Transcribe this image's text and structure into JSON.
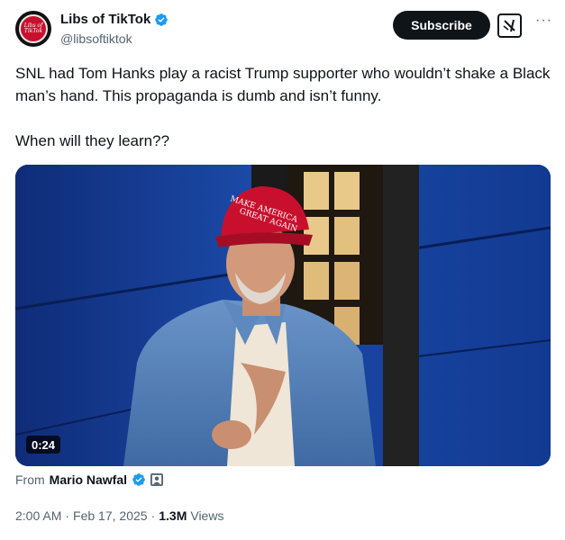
{
  "author": {
    "display_name": "Libs of TikTok",
    "handle": "@libsoftiktok",
    "avatar_text": "Libs of TikTok",
    "verified": true
  },
  "header_actions": {
    "subscribe_label": "Subscribe",
    "grok_icon": "grok-icon",
    "more_icon": "more-icon"
  },
  "tweet": {
    "text_line_1": "SNL had Tom Hanks play a racist Trump supporter who wouldn’t shake a Black man’s hand. This propaganda is dumb and isn’t funny.",
    "text_line_2": "When will they learn??"
  },
  "media": {
    "duration": "0:24",
    "hat_text_1": "MAKE AMERICA",
    "hat_text_2": "GREAT AGAIN",
    "colors": {
      "backdrop": "#163a8a",
      "hat": "#c8102e",
      "shirt": "#4f7bb3"
    }
  },
  "attribution": {
    "prefix": "From",
    "name": "Mario Nawfal",
    "verified": true
  },
  "meta": {
    "time": "2:00 AM",
    "separator": "·",
    "date": "Feb 17, 2025",
    "views_count": "1.3M",
    "views_label": "Views"
  }
}
